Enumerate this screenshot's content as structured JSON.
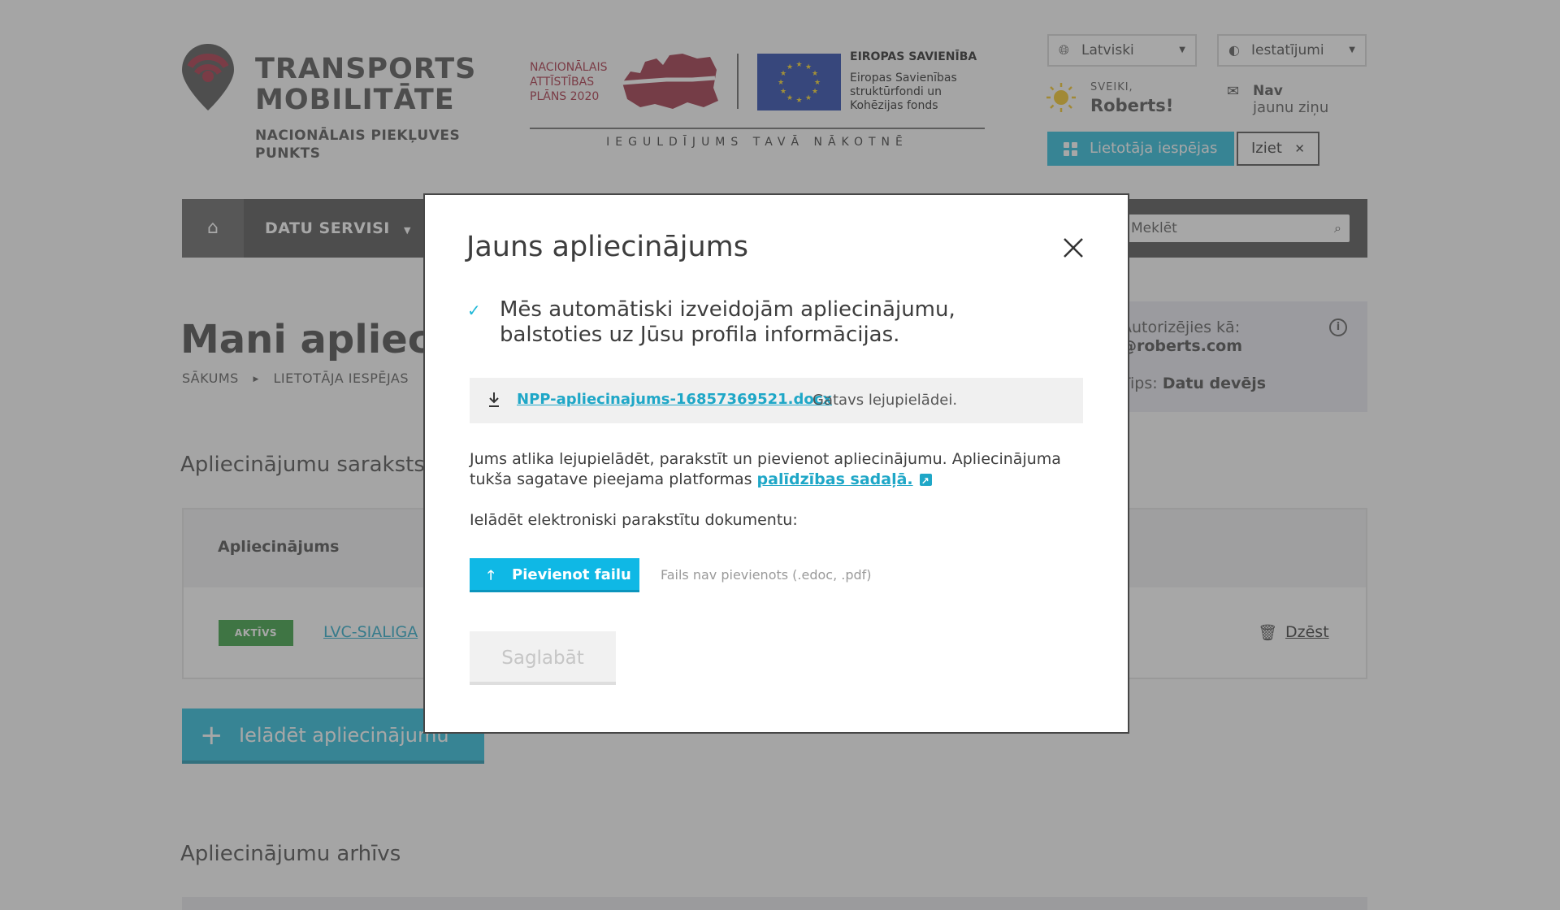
{
  "brand": {
    "name": "TRANSPORTS\nMOBILITĀTE",
    "subtitle": "NACIONĀLAIS PIEKĻUVES PUNKTS",
    "nap_text": "NACIONĀLAIS ATTĪSTĪBAS PLĀNS 2020",
    "eu_title": "EIROPAS SAVIENĪBA",
    "eu_sub": "Eiropas Savienības struktūrfondi un Kohēzijas fonds",
    "invest": "IEGULDĪJUMS TAVĀ NĀKOTNĒ",
    "colors": {
      "accent": "#1fb8d8",
      "brand_red": "#a5283c",
      "eu_blue": "#1f3ea8",
      "eu_star": "#f7d21e"
    }
  },
  "header": {
    "language": "Latviski",
    "settings": "Iestatījumi",
    "greeting_small": "SVEIKI,",
    "greeting_name": "Roberts!",
    "messages_top": "Nav",
    "messages_bottom": "jaunu ziņu",
    "user_options": "Lietotāja iespējas",
    "logout": "Iziet",
    "icons": {
      "language": "globe-icon",
      "settings": "contrast-icon",
      "greeting": "sun-icon",
      "messages": "mail-icon",
      "user_options": "grid-icon",
      "logout": "close-icon"
    }
  },
  "nav": {
    "home_icon": "home-icon",
    "items": [
      {
        "label": "DATU SERVISI"
      }
    ],
    "search_placeholder": "Meklēt"
  },
  "content": {
    "title": "Mani apliecinājumi",
    "breadcrumb": [
      "SĀKUMS",
      "LIETOTĀJA IESPĒJAS"
    ],
    "info": {
      "label": "Autorizējies kā:",
      "email": "@roberts.com",
      "type_label": "Tips:",
      "type_value": "Datu devējs"
    },
    "list_title": "Apliecinājumu saraksts",
    "table": {
      "header": "Apliecinājums",
      "rows": [
        {
          "status": "AKTĪVS",
          "name": "LVC-SIALIGA",
          "delete": "Dzēst"
        }
      ]
    },
    "upload_button": "Ielādēt apliecinājumu",
    "archive_title": "Apliecinājumu arhīvs"
  },
  "modal": {
    "title": "Jauns apliecinājums",
    "notice": "Mēs automātiski izveidojām apliecinājumu, balstoties uz Jūsu profila informācijas.",
    "file_name": "NPP-apliecinajums-16857369521.docx",
    "file_status": "Gatavs lejupielādei.",
    "instructions": "Jums atlika lejupielādēt, parakstīt un pievienot apliecinājumu. Apliecinājuma tukša sagatave pieejama platformas",
    "help_link": "palīdzības sadaļā.",
    "upload_label": "Ielādēt elektroniski parakstītu dokumentu:",
    "add_file": "Pievienot failu",
    "no_file": "Fails nav pievienots (.edoc, .pdf)",
    "save": "Saglabāt"
  }
}
